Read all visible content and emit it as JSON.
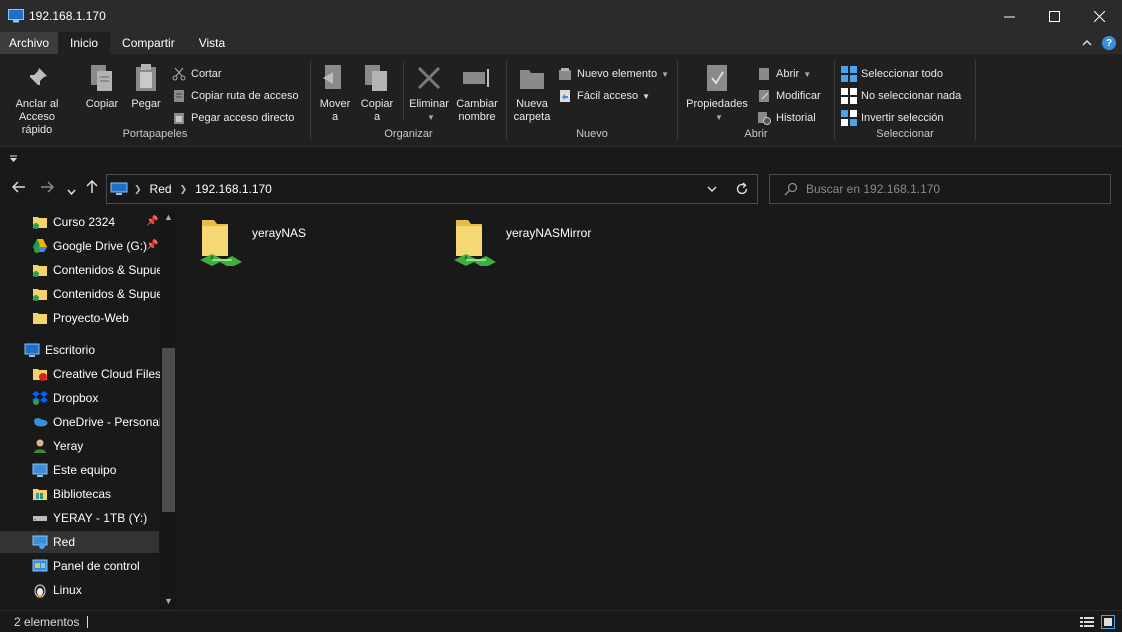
{
  "window": {
    "title": "192.168.1.170"
  },
  "tabs": [
    {
      "label": "Archivo"
    },
    {
      "label": "Inicio"
    },
    {
      "label": "Compartir"
    },
    {
      "label": "Vista"
    }
  ],
  "ribbon": {
    "portapapeles": {
      "label": "Portapapeles",
      "pin": "Anclar al Acceso rápido",
      "copy": "Copiar",
      "paste": "Pegar",
      "cut": "Cortar",
      "copy_path": "Copiar ruta de acceso",
      "paste_shortcut": "Pegar acceso directo"
    },
    "organizar": {
      "label": "Organizar",
      "move_l1": "Mover",
      "move_l2": "a",
      "copy_l1": "Copiar",
      "copy_l2": "a",
      "delete": "Eliminar",
      "rename_l1": "Cambiar",
      "rename_l2": "nombre"
    },
    "nuevo": {
      "label": "Nuevo",
      "new_folder_l1": "Nueva",
      "new_folder_l2": "carpeta",
      "new_item": "Nuevo elemento",
      "easy_access": "Fácil acceso"
    },
    "abrir": {
      "label": "Abrir",
      "properties": "Propiedades",
      "open": "Abrir",
      "edit": "Modificar",
      "history": "Historial"
    },
    "seleccionar": {
      "label": "Seleccionar",
      "select_all": "Seleccionar todo",
      "select_none": "No seleccionar nada",
      "invert": "Invertir selección"
    }
  },
  "address": {
    "crumbs": [
      "Red",
      "192.168.1.170"
    ],
    "search_placeholder": "Buscar en 192.168.1.170"
  },
  "sidebar": {
    "items": [
      {
        "label": "Curso 2324",
        "icon": "folder-sync-icon",
        "pinned": true
      },
      {
        "label": "Google Drive (G:)",
        "icon": "google-drive-icon",
        "pinned": true
      },
      {
        "label": "Contenidos & Supue",
        "icon": "folder-sync-icon"
      },
      {
        "label": "Contenidos & Supue",
        "icon": "folder-sync-icon"
      },
      {
        "label": "Proyecto-Web",
        "icon": "folder-icon"
      },
      {
        "label": "Escritorio",
        "icon": "desktop-icon"
      },
      {
        "label": "Creative Cloud Files",
        "icon": "creative-cloud-icon"
      },
      {
        "label": "Dropbox",
        "icon": "dropbox-icon"
      },
      {
        "label": "OneDrive - Personal",
        "icon": "onedrive-icon"
      },
      {
        "label": "Yeray",
        "icon": "user-icon"
      },
      {
        "label": "Este equipo",
        "icon": "computer-icon"
      },
      {
        "label": "Bibliotecas",
        "icon": "libraries-icon"
      },
      {
        "label": "YERAY - 1TB (Y:)",
        "icon": "drive-icon"
      },
      {
        "label": "Red",
        "icon": "network-icon",
        "selected": true
      },
      {
        "label": "Panel de control",
        "icon": "control-panel-icon"
      },
      {
        "label": "Linux",
        "icon": "linux-icon"
      }
    ]
  },
  "content": {
    "items": [
      {
        "name": "yerayNAS",
        "icon": "network-share-icon"
      },
      {
        "name": "yerayNASMirror",
        "icon": "network-share-icon"
      }
    ]
  },
  "status": {
    "count": "2 elementos"
  },
  "colors": {
    "background": "#191919",
    "titlebar": "#2b2b2b",
    "ribbon": "#202020",
    "folder": "#f4d36b",
    "accent": "#3b8eda"
  }
}
